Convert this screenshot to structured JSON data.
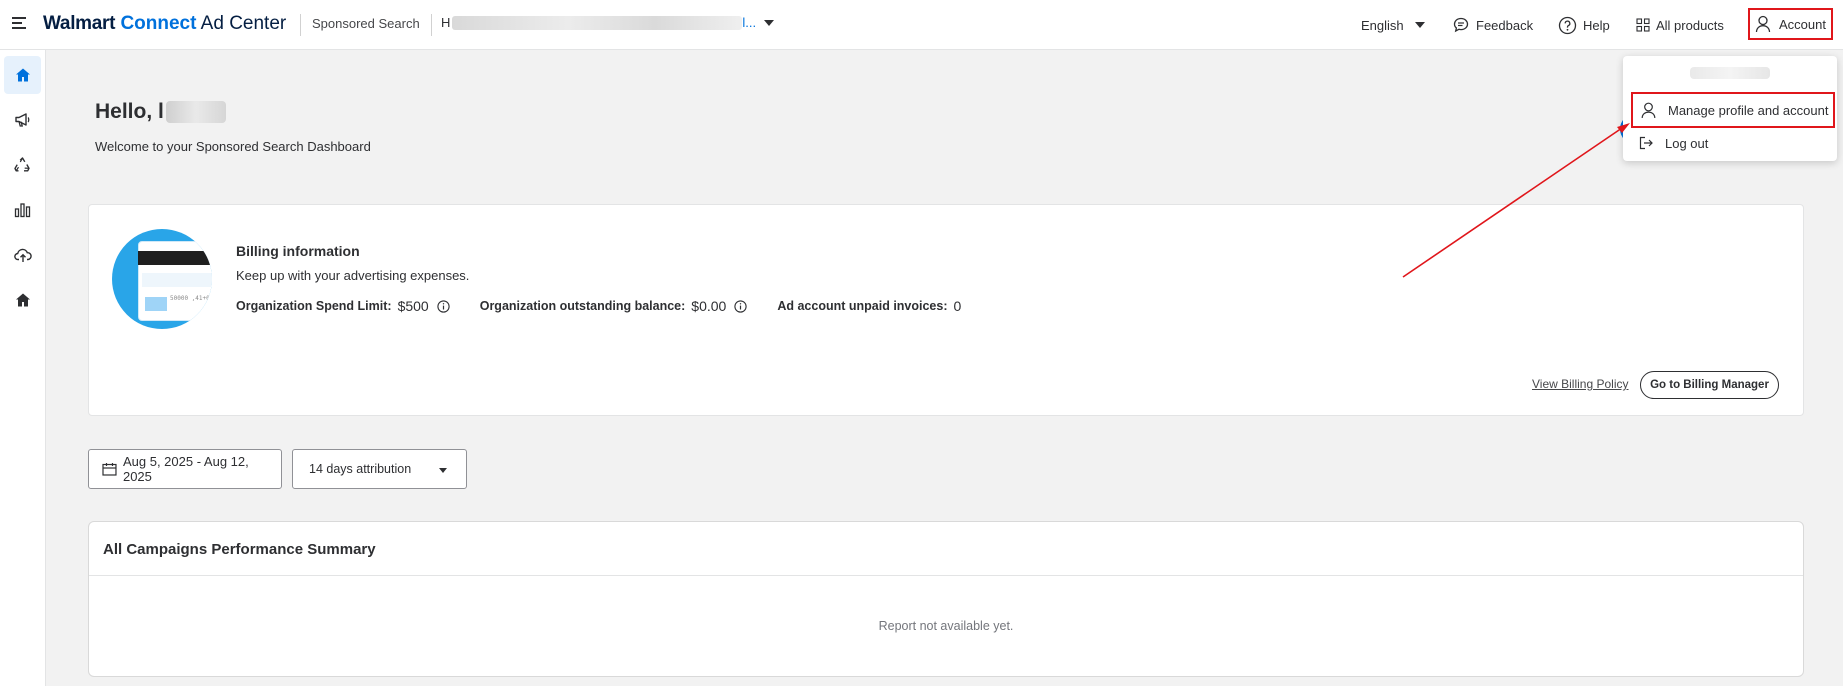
{
  "header": {
    "logo": {
      "walmart": "Walmart",
      "connect": "Connect",
      "adcenter": "Ad Center"
    },
    "product": "Sponsored Search",
    "account_prefix": "H",
    "account_suffix": "l...",
    "language": "English",
    "feedback": "Feedback",
    "help": "Help",
    "all_products": "All products",
    "account": "Account"
  },
  "sidebar": {
    "items": [
      {
        "icon": "home-icon",
        "active": true
      },
      {
        "icon": "megaphone-icon",
        "active": false
      },
      {
        "icon": "recycle-icon",
        "active": false
      },
      {
        "icon": "bar-chart-icon",
        "active": false
      },
      {
        "icon": "cloud-upload-icon",
        "active": false
      },
      {
        "icon": "house-icon",
        "active": false
      }
    ]
  },
  "main": {
    "greeting": "Hello, l",
    "welcome": "Welcome to your Sponsored Search Dashboard"
  },
  "billing": {
    "title": "Billing information",
    "subtitle": "Keep up with your advertising expenses.",
    "card_number": "50000 ,41+0",
    "spend_limit_label": "Organization Spend Limit:",
    "spend_limit_value": "$500",
    "outstanding_label": "Organization outstanding balance:",
    "outstanding_value": "$0.00",
    "unpaid_label": "Ad account unpaid invoices:",
    "unpaid_value": "0",
    "view_policy": "View Billing Policy",
    "go_billing": "Go to Billing Manager"
  },
  "filters": {
    "date_range": "Aug 5, 2025 - Aug 12, 2025",
    "attribution": "14 days attribution"
  },
  "performance": {
    "title": "All Campaigns Performance Summary",
    "empty_message": "Report not available yet."
  },
  "account_menu": {
    "manage": "Manage profile and account",
    "logout": "Log out"
  },
  "colors": {
    "brand_blue": "#0071dc",
    "brand_navy": "#041e42",
    "highlight_red": "#e0161b"
  }
}
